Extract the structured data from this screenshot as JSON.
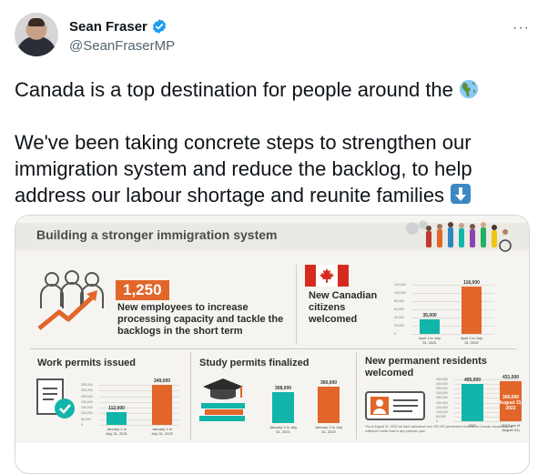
{
  "tweet": {
    "author_name": "Sean Fraser",
    "handle": "@SeanFraserMP",
    "more_label": "···",
    "line1": "Canada is a top destination for people around the",
    "line2": "We've been taking concrete steps to strengthen our immigration system and reduce the backlog, to help address our labour shortage and reunite families",
    "colors": {
      "verified": "#1d9bf0",
      "text": "#0f1419",
      "muted": "#536471"
    }
  },
  "infographic": {
    "title": "Building a stronger immigration system",
    "employees": {
      "value": "1,250",
      "description": "New employees to increase processing capacity and tackle the backlogs in the short term"
    },
    "citizens": {
      "title": "New Canadian citizens welcomed",
      "chart_data": {
        "type": "bar",
        "categories": [
          "April 1 to July 31, 2021",
          "April 1 to July 31, 2022"
        ],
        "values": [
          35000,
          116000
        ],
        "value_labels": [
          "35,000",
          "116,000"
        ],
        "ylim": [
          0,
          120000
        ],
        "yticks": [
          "120,000",
          "100,000",
          "80,000",
          "60,000",
          "40,000",
          "20,000",
          "0"
        ]
      }
    },
    "work": {
      "title": "Work permits issued",
      "chart_data": {
        "type": "bar",
        "categories": [
          "January 1 to July 31, 2021",
          "January 1 to July 31, 2022"
        ],
        "values": [
          112000,
          349000
        ],
        "value_labels": [
          "112,000",
          "349,000"
        ],
        "ylim": [
          0,
          350000
        ],
        "yticks": [
          "350,000",
          "300,000",
          "250,000",
          "200,000",
          "150,000",
          "100,000",
          "50,000",
          "0"
        ]
      }
    },
    "study": {
      "title": "Study permits finalized",
      "chart_data": {
        "type": "bar",
        "categories": [
          "January 1 to July 31, 2021",
          "January 1 to July 31, 2022"
        ],
        "values": [
          308000,
          360000
        ],
        "value_labels": [
          "308,000",
          "360,000"
        ],
        "ylim": [
          0,
          400000
        ]
      }
    },
    "residents": {
      "title": "New permanent residents welcomed",
      "footnote": "*As of August 31, 2022 we have welcomed over 300,000 permanent residents to Canada, surpassing the milestone earlier than in any previous year.",
      "chart_data": {
        "type": "bar",
        "categories": [
          "2021",
          "2022 (as of August 31)"
        ],
        "values": [
          405000,
          431000
        ],
        "value_labels": [
          "405,000",
          "431,000"
        ],
        "sub_label": "300,000 August 31, 2022",
        "ylim": [
          0,
          450000
        ],
        "yticks": [
          "450,000",
          "400,000",
          "350,000",
          "300,000",
          "250,000",
          "200,000",
          "150,000",
          "100,000",
          "50,000",
          "0"
        ]
      }
    },
    "colors": {
      "teal": "#12b5a9",
      "orange": "#e2662a",
      "panel": "#f5f4f1",
      "header": "#ebe9e4",
      "red": "#d52b1e"
    }
  }
}
